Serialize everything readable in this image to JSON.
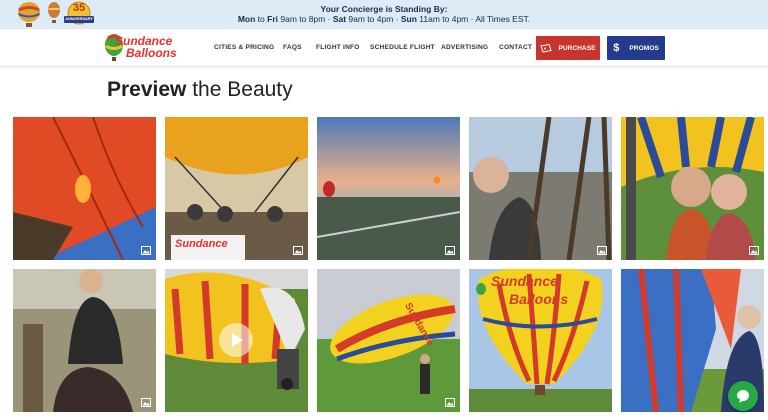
{
  "banner": {
    "heading": "Your Concierge is Standing By:",
    "hours": {
      "mon": "Mon",
      "to1": " to ",
      "fri": "Fri",
      "weekday_hours": " 9am to 8pm · ",
      "sat": "Sat",
      "sat_hours": " 9am to 4pm · ",
      "sun": "Sun",
      "sun_hours": " 11am to 4pm · All Times EST."
    },
    "anniversary_number": "35",
    "anniversary_text": "ANNIVERSARY"
  },
  "logo": {
    "line1": "Sundance",
    "line2": "Balloons"
  },
  "nav": {
    "links": [
      "CITIES & PRICING",
      "FAQS",
      "FLIGHT INFO",
      "SCHEDULE FLIGHT",
      "ADVERTISING",
      "CONTACT"
    ],
    "purchase_label": "PURCHASE",
    "promos_label": "PROMOS",
    "promos_icon": "$"
  },
  "gallery": {
    "title_bold": "Preview",
    "title_rest": " the Beauty",
    "balloon_text": [
      "Sundance",
      "Balloons"
    ],
    "tiles": [
      {
        "kind": "photo",
        "icon": "image-icon"
      },
      {
        "kind": "photo",
        "icon": "image-icon"
      },
      {
        "kind": "photo",
        "icon": "image-icon"
      },
      {
        "kind": "photo",
        "icon": "image-icon"
      },
      {
        "kind": "photo",
        "icon": "image-icon"
      },
      {
        "kind": "photo",
        "icon": "image-icon"
      },
      {
        "kind": "video",
        "icon": "play-icon"
      },
      {
        "kind": "photo",
        "icon": "image-icon"
      },
      {
        "kind": "photo",
        "icon": "image-icon"
      },
      {
        "kind": "photo",
        "icon": "image-icon"
      }
    ]
  },
  "colors": {
    "banner_bg": "#dcebf5",
    "purchase": "#c8352c",
    "promos": "#243a8c",
    "chat": "#27a745"
  }
}
